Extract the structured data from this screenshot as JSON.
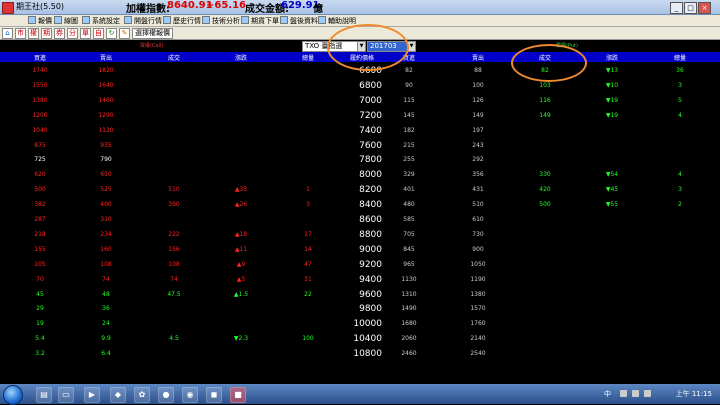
{
  "titlebar": {
    "app_title": "期王社(5.50)",
    "index_label": "加權指數:",
    "index_value": "8640.91",
    "index_change": "+65.16",
    "amount_label": "成交金額:",
    "amount_value": "629.91",
    "amount_unit": "億",
    "minimize": "_",
    "maximize": "□",
    "close": "×"
  },
  "menu": [
    {
      "label": "報價"
    },
    {
      "label": "線圖"
    },
    {
      "label": "系統設定"
    },
    {
      "label": "開盤行情"
    },
    {
      "label": "歷史行情"
    },
    {
      "label": "技術分析"
    },
    {
      "label": "期貨下單"
    },
    {
      "label": "盤後資料"
    },
    {
      "label": "輔助說明"
    }
  ],
  "toolbar": {
    "buttons": [
      "市",
      "權",
      "期",
      "券",
      "分",
      "單",
      "自"
    ],
    "select_label": "選擇權報價"
  },
  "controls": {
    "left_pane_label": "買權(Call)",
    "right_pane_label": "賣權(Put)",
    "contract_select": "TXO 臺指選",
    "month_select": "201703"
  },
  "header": {
    "left": [
      "買進",
      "賣出",
      "成交",
      "漲跌",
      "總量"
    ],
    "strike": "履約價格",
    "right": [
      "買進",
      "賣出",
      "成交",
      "漲跌",
      "總量"
    ]
  },
  "rows": [
    {
      "strike": "6600",
      "cb": "1740",
      "cs": "1820",
      "cl": "",
      "cc": "",
      "cv": "",
      "pb": "82",
      "ps": "88",
      "pl": "82",
      "pc": "▼13",
      "pv": "36",
      "call_color": "red",
      "put_color": "grn"
    },
    {
      "strike": "6800",
      "cb": "1550",
      "cs": "1640",
      "cl": "",
      "cc": "",
      "cv": "",
      "pb": "90",
      "ps": "100",
      "pl": "103",
      "pc": "▼10",
      "pv": "3",
      "call_color": "red",
      "put_color": "grn"
    },
    {
      "strike": "7000",
      "cb": "1380",
      "cs": "1460",
      "cl": "",
      "cc": "",
      "cv": "",
      "pb": "115",
      "ps": "126",
      "pl": "116",
      "pc": "▼19",
      "pv": "5",
      "call_color": "red",
      "put_color": "grn"
    },
    {
      "strike": "7200",
      "cb": "1200",
      "cs": "1290",
      "cl": "",
      "cc": "",
      "cv": "",
      "pb": "145",
      "ps": "149",
      "pl": "149",
      "pc": "▼19",
      "pv": "4",
      "call_color": "red",
      "put_color": "grn"
    },
    {
      "strike": "7400",
      "cb": "1040",
      "cs": "1120",
      "cl": "",
      "cc": "",
      "cv": "",
      "pb": "182",
      "ps": "197",
      "pl": "",
      "pc": "",
      "pv": "",
      "call_color": "red",
      "put_color": "grn"
    },
    {
      "strike": "7600",
      "cb": "875",
      "cs": "935",
      "cl": "",
      "cc": "",
      "cv": "",
      "pb": "215",
      "ps": "243",
      "pl": "",
      "pc": "",
      "pv": "",
      "call_color": "red",
      "put_color": "grn"
    },
    {
      "strike": "7800",
      "cb": "725",
      "cs": "790",
      "cl": "",
      "cc": "",
      "cv": "",
      "pb": "255",
      "ps": "292",
      "pl": "",
      "pc": "",
      "pv": "",
      "call_color": "wht",
      "put_color": "grn"
    },
    {
      "strike": "8000",
      "cb": "620",
      "cs": "650",
      "cl": "",
      "cc": "",
      "cv": "",
      "pb": "329",
      "ps": "356",
      "pl": "330",
      "pc": "▼54",
      "pv": "4",
      "call_color": "red",
      "put_color": "grn"
    },
    {
      "strike": "8200",
      "cb": "500",
      "cs": "525",
      "cl": "510",
      "cc": "▲33",
      "cv": "1",
      "pb": "401",
      "ps": "431",
      "pl": "420",
      "pc": "▼45",
      "pv": "3",
      "call_color": "red",
      "put_color": "grn"
    },
    {
      "strike": "8400",
      "cb": "382",
      "cs": "400",
      "cl": "390",
      "cc": "▲26",
      "cv": "3",
      "pb": "480",
      "ps": "510",
      "pl": "500",
      "pc": "▼55",
      "pv": "2",
      "call_color": "red",
      "put_color": "grn"
    },
    {
      "strike": "8600",
      "cb": "287",
      "cs": "310",
      "cl": "",
      "cc": "",
      "cv": "",
      "pb": "585",
      "ps": "610",
      "pl": "",
      "pc": "",
      "pv": "",
      "call_color": "red",
      "put_color": "grn"
    },
    {
      "strike": "8800",
      "cb": "218",
      "cs": "234",
      "cl": "222",
      "cc": "▲18",
      "cv": "17",
      "pb": "705",
      "ps": "730",
      "pl": "",
      "pc": "",
      "pv": "",
      "call_color": "red",
      "put_color": "grn"
    },
    {
      "strike": "9000",
      "cb": "155",
      "cs": "160",
      "cl": "156",
      "cc": "▲11",
      "cv": "14",
      "pb": "845",
      "ps": "900",
      "pl": "",
      "pc": "",
      "pv": "",
      "call_color": "red",
      "put_color": "grn"
    },
    {
      "strike": "9200",
      "cb": "105",
      "cs": "108",
      "cl": "108",
      "cc": "▲9",
      "cv": "47",
      "pb": "965",
      "ps": "1050",
      "pl": "",
      "pc": "",
      "pv": "",
      "call_color": "red",
      "put_color": "grn"
    },
    {
      "strike": "9400",
      "cb": "70",
      "cs": "74",
      "cl": "74",
      "cc": "▲5",
      "cv": "31",
      "pb": "1130",
      "ps": "1190",
      "pl": "",
      "pc": "",
      "pv": "",
      "call_color": "red",
      "put_color": "grn"
    },
    {
      "strike": "9600",
      "cb": "45",
      "cs": "48",
      "cl": "47.5",
      "cc": "▲1.5",
      "cv": "22",
      "pb": "1310",
      "ps": "1380",
      "pl": "",
      "pc": "",
      "pv": "",
      "call_color": "grn",
      "put_color": "grn"
    },
    {
      "strike": "9800",
      "cb": "29",
      "cs": "36",
      "cl": "",
      "cc": "",
      "cv": "",
      "pb": "1490",
      "ps": "1570",
      "pl": "",
      "pc": "",
      "pv": "",
      "call_color": "grn",
      "put_color": "grn"
    },
    {
      "strike": "10000",
      "cb": "19",
      "cs": "24",
      "cl": "",
      "cc": "",
      "cv": "",
      "pb": "1680",
      "ps": "1760",
      "pl": "",
      "pc": "",
      "pv": "",
      "call_color": "grn",
      "put_color": "grn"
    },
    {
      "strike": "10400",
      "cb": "5.4",
      "cs": "9.9",
      "cl": "4.5",
      "cc": "▼2.3",
      "cv": "100",
      "pb": "2060",
      "ps": "2140",
      "pl": "",
      "pc": "",
      "pv": "",
      "call_color": "grn",
      "put_color": "grn"
    },
    {
      "strike": "10800",
      "cb": "3.2",
      "cs": "6.4",
      "cl": "",
      "cc": "",
      "cv": "",
      "pb": "2460",
      "ps": "2540",
      "pl": "",
      "pc": "",
      "pv": "",
      "call_color": "grn",
      "put_color": "grn"
    }
  ],
  "taskbar": {
    "language": "中",
    "clock": "上午 11:15"
  },
  "colors": {
    "header_bg": "#0000c8",
    "up_red": "#ff2222",
    "down_green": "#22ff22",
    "annotation_orange": "#f08a2e"
  }
}
